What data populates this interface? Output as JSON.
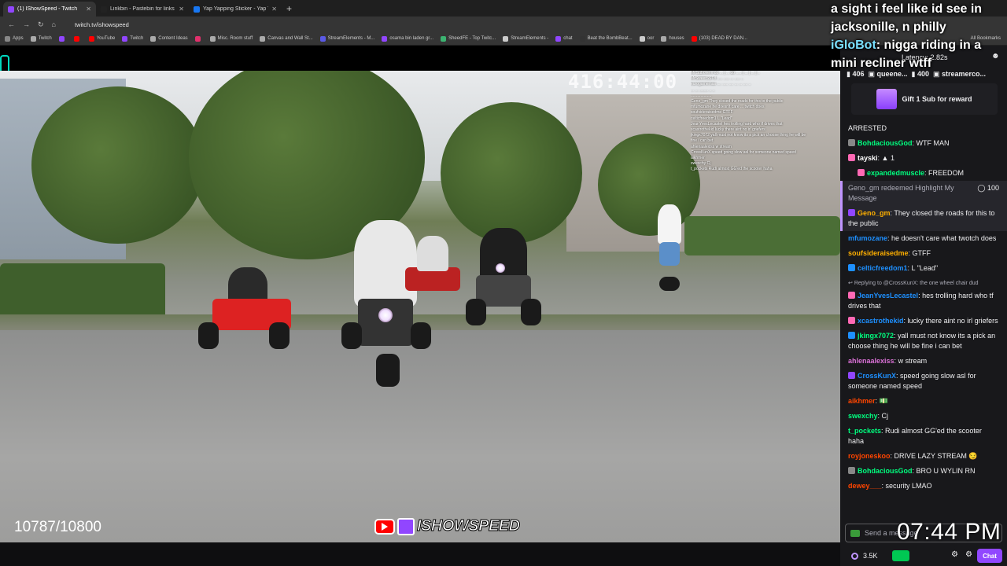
{
  "browser": {
    "tabs": [
      {
        "title": "(1) IShowSpeed - Twitch",
        "color": "#9146ff",
        "active": true
      },
      {
        "title": "Linkbin - Pastebin for links",
        "color": "#222222",
        "active": false
      },
      {
        "title": "Yap Yapping Sticker - Yap Yappi...",
        "color": "#1877f2",
        "active": false
      }
    ],
    "new_tab": "+",
    "url": "twitch.tv/ishowspeed",
    "bookmarks": [
      {
        "label": "Apps",
        "color": "#888888"
      },
      {
        "label": "Twitch",
        "color": "#aaaaaa"
      },
      {
        "label": "",
        "color": "#9146ff"
      },
      {
        "label": "",
        "color": "#ff0000"
      },
      {
        "label": "YouTube",
        "color": "#ff0000"
      },
      {
        "label": "Twitch",
        "color": "#9146ff"
      },
      {
        "label": "Content Ideas",
        "color": "#aaaaaa"
      },
      {
        "label": "",
        "color": "#e1306c"
      },
      {
        "label": "Misc. Room stuff",
        "color": "#aaaaaa"
      },
      {
        "label": "Canvas and Wall St...",
        "color": "#aaaaaa"
      },
      {
        "label": "StreamElements - M...",
        "color": "#5a5ae6"
      },
      {
        "label": "osama bin laden gr...",
        "color": "#9146ff"
      },
      {
        "label": "SheedFE - Top Twitc...",
        "color": "#3cb371"
      },
      {
        "label": "StreamElements -",
        "color": "#cccccc"
      },
      {
        "label": "chat",
        "color": "#9146ff"
      },
      {
        "label": "Beat the BombBeat...",
        "color": "#333333"
      },
      {
        "label": "oor",
        "color": "#cccccc"
      },
      {
        "label": "houses",
        "color": "#aaaaaa"
      },
      {
        "label": "(103) DEAD BY DAN...",
        "color": "#ff0000"
      }
    ],
    "all_bookmarks": "All Bookmarks"
  },
  "video": {
    "timer": "416:44:00",
    "sub_count": "10787/10800",
    "channel_logo_text": "ISHOWSPEED",
    "overlay_chat": [
      "Mr.Subovern do ... | ... do ..... | ... | ... | ..",
      "MrSweetSST8 ..... ..... ... ..... ..",
      "eurogamemas .... ..... .... ... ... .... ..",
      "... ... ........ .. ..",
      "...................",
      "Geno_gm They closed the roads for this to the public",
      "mfumozane he doesn't care ... twitch does",
      "soufsideraisedme GTFF",
      "celticfreedom1 L \"Lead\"",
      "JeanYvesLecastel hes trolling hard who tf drives that",
      "xcastrothekid lucky there aint no irl griefers",
      "jkingx7072 yall must not know its a pick an choose thing he will be",
      "fine i can bet",
      "ahlenaalexiss w stream",
      "CrossKunX speed going slow asl for someone named speed",
      "aikhmer",
      "swexchy Cj",
      "t_pockets Rudi almost GG'ed the scooter haha"
    ],
    "overlay_message": {
      "line1": "a sight i feel like id see in",
      "line2": "jacksonille, n philly",
      "username": "iGloBot",
      "line3": ": nigga riding in a",
      "line4": "mini recliner wtff"
    }
  },
  "chat": {
    "latency": "Latency: 2.82s",
    "pinned": [
      {
        "count": "406"
      },
      {
        "name": "queene...",
        "count": "400"
      },
      {
        "name": "streamerco..."
      }
    ],
    "gift_label": "Gift 1 Sub for reward",
    "messages": [
      {
        "type": "plain",
        "text": "ARRESTED"
      },
      {
        "user": "BohdaciousGod",
        "color": "#00ff7f",
        "text": "WTF MAN",
        "badge": "#888888"
      },
      {
        "user": "tayski",
        "color": "#ffffff",
        "text": "▲ 1",
        "badge": "#ff69b4"
      },
      {
        "user": "expandedmuscle",
        "color": "#00ff7f",
        "text": "FREEDOM",
        "badge": "#ff69b4",
        "indent": true
      },
      {
        "type": "highlight",
        "user": "Geno_gm",
        "redeem": "redeemed Highlight My Message",
        "points": "100"
      },
      {
        "user": "Geno_gm",
        "color": "#ffb000",
        "text": "They closed the roads for this to the public",
        "badge": "#9146ff",
        "hl": true
      },
      {
        "user": "mfumozane",
        "color": "#1e90ff",
        "text": "he doesn't care what twotch does"
      },
      {
        "user": "soufsideraisedme",
        "color": "#ffb000",
        "text": "GTFF"
      },
      {
        "user": "celticfreedom1",
        "color": "#1e90ff",
        "text": "L \"Lead\"",
        "badge": "#1e90ff"
      },
      {
        "type": "reply",
        "text": "Replying to @CrossKunX: the one wheel chair dud"
      },
      {
        "user": "JeanYvesLecastel",
        "color": "#1e90ff",
        "text": "hes trolling hard who tf drives that",
        "badge": "#ff69b4"
      },
      {
        "user": "xcastrothekid",
        "color": "#1e90ff",
        "text": "lucky there aint no irl griefers",
        "badge": "#ff69b4"
      },
      {
        "user": "jkingx7072",
        "color": "#00ff7f",
        "text": "yall must not know its a pick an choose thing he will be fine i can bet",
        "badge": "#1e90ff"
      },
      {
        "user": "ahlenaalexiss",
        "color": "#da70d6",
        "text": "w stream"
      },
      {
        "user": "CrossKunX",
        "color": "#1e90ff",
        "text": "speed going slow asl for someone named speed",
        "badge": "#9146ff"
      },
      {
        "user": "aikhmer",
        "color": "#ff4500",
        "text": "💵"
      },
      {
        "user": "swexchy",
        "color": "#00ff7f",
        "text": "Cj"
      },
      {
        "user": "t_pockets",
        "color": "#00ff7f",
        "text": "Rudi almost GG'ed the scooter haha"
      },
      {
        "user": "royjoneskoo",
        "color": "#ff4500",
        "text": "DRIVE LAZY STREAM 😏"
      },
      {
        "user": "BohdaciousGod",
        "color": "#00ff7f",
        "text": "BRO U WYLIN RN",
        "badge": "#888888"
      },
      {
        "user": "dewey___",
        "color": "#ff4500",
        "text": "security LMAO"
      }
    ],
    "send_placeholder": "Send a message",
    "points": "3.5K",
    "chat_button": "Chat",
    "clock": "07:44 PM"
  }
}
